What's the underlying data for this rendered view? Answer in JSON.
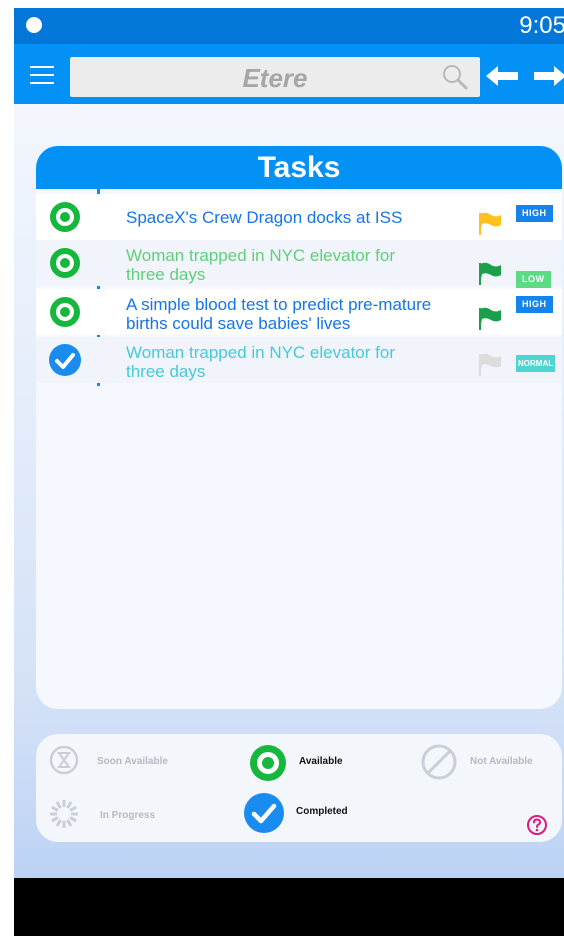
{
  "status_bar": {
    "time": "9:05"
  },
  "toolbar": {
    "search_text": "Etere",
    "menu_icon": "hamburger-menu-icon",
    "back_icon": "arrow-left-icon",
    "forward_icon": "arrow-right-icon"
  },
  "tasks": {
    "title": "Tasks",
    "items": [
      {
        "title": "SpaceX's Crew Dragon docks at ISS",
        "status": "available",
        "priority": "HIGH",
        "title_color": "#1675e8",
        "flag_color": "#ffc21c",
        "badge_color": "#1484ec"
      },
      {
        "title": "Woman trapped in NYC elevator for three days",
        "status": "available",
        "priority": "LOW",
        "title_color": "#5ed07a",
        "flag_color": "#1aa04a",
        "badge_color": "#5cdc82"
      },
      {
        "title": "A simple blood test to predict pre-mature births could save babies' lives",
        "status": "available",
        "priority": "HIGH",
        "title_color": "#1675e8",
        "flag_color": "#1aa04a",
        "badge_color": "#1484ec"
      },
      {
        "title": "Woman trapped in NYC elevator for three days",
        "status": "completed",
        "priority": "NORMAL",
        "title_color": "#46c9d9",
        "flag_color": "#dcdcdc",
        "badge_color": "#4fd4d2"
      }
    ]
  },
  "legend": {
    "soon_available": "Soon Available",
    "available": "Available",
    "not_available": "Not Available",
    "in_progress": "In Progress",
    "completed": "Completed"
  },
  "colors": {
    "primary": "#0391f6",
    "available": "#15b83c",
    "completed": "#1a8cf0",
    "help": "#e0197c"
  }
}
